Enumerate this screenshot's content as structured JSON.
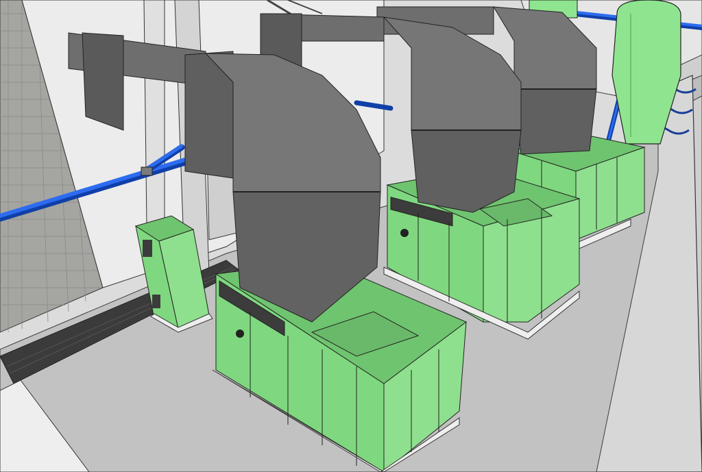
{
  "scene": {
    "subject": "",
    "colors": {
      "background": "#dcdcdc",
      "wall": "#e6e6e6",
      "floor": "#c2c2c2",
      "stone": "#a5a5a1",
      "duct_front": "#6e6e6e",
      "duct_side": "#5a5a5a",
      "duct_top": "#7d7d7d",
      "unit_top": "#6fc46f",
      "unit_front": "#7fd87f",
      "unit_side": "#8ee08e",
      "pipe": "#1f5bd8",
      "tank": "#8fe58f",
      "outline": "#2a2a2a"
    }
  }
}
